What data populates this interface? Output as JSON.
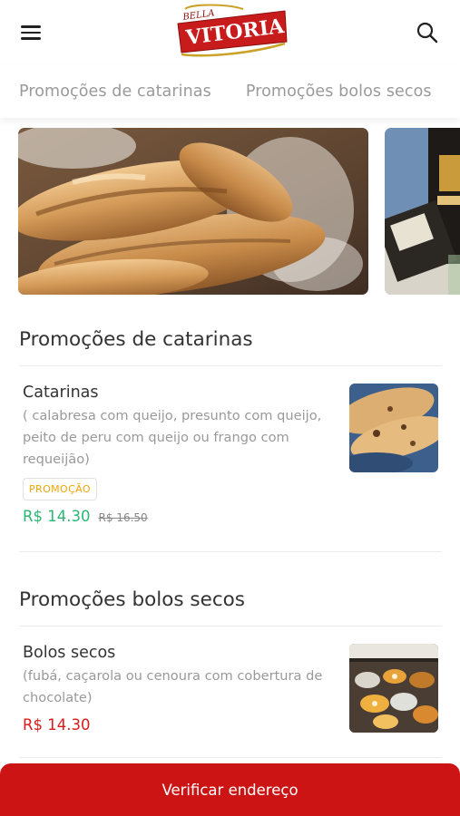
{
  "header": {
    "logo_top": "BELLA",
    "logo_main": "VITORIA",
    "menu_icon": "hamburger-menu-icon",
    "search_icon": "search-icon"
  },
  "tabs": [
    {
      "label": "Promoções de catarinas"
    },
    {
      "label": "Promoções bolos secos"
    }
  ],
  "banners": [
    {
      "image": "bread-loaves-photo"
    },
    {
      "image": "wine-bottles-photo"
    }
  ],
  "sections": [
    {
      "title": "Promoções de catarinas",
      "products": [
        {
          "name": "Catarinas",
          "description": "( calabresa com queijo, presunto com queijo, peito de peru com queijo ou frango com requeijão)",
          "badge": "PROMOÇÃO",
          "price": "R$ 14.30",
          "old_price": "R$ 16.50",
          "image": "catarinas-photo"
        }
      ]
    },
    {
      "title": "Promoções bolos secos",
      "products": [
        {
          "name": "Bolos secos",
          "description": "(fubá, caçarola ou cenoura com cobertura de chocolate)",
          "price": "R$ 14.30",
          "image": "bolos-secos-photo"
        }
      ]
    }
  ],
  "footer": {
    "button_label": "Verificar endereço"
  },
  "colors": {
    "brand_red": "#cc1414",
    "promo_price_green": "#2bb673",
    "price_red": "#d91b1b",
    "badge_orange": "#f0a400"
  }
}
